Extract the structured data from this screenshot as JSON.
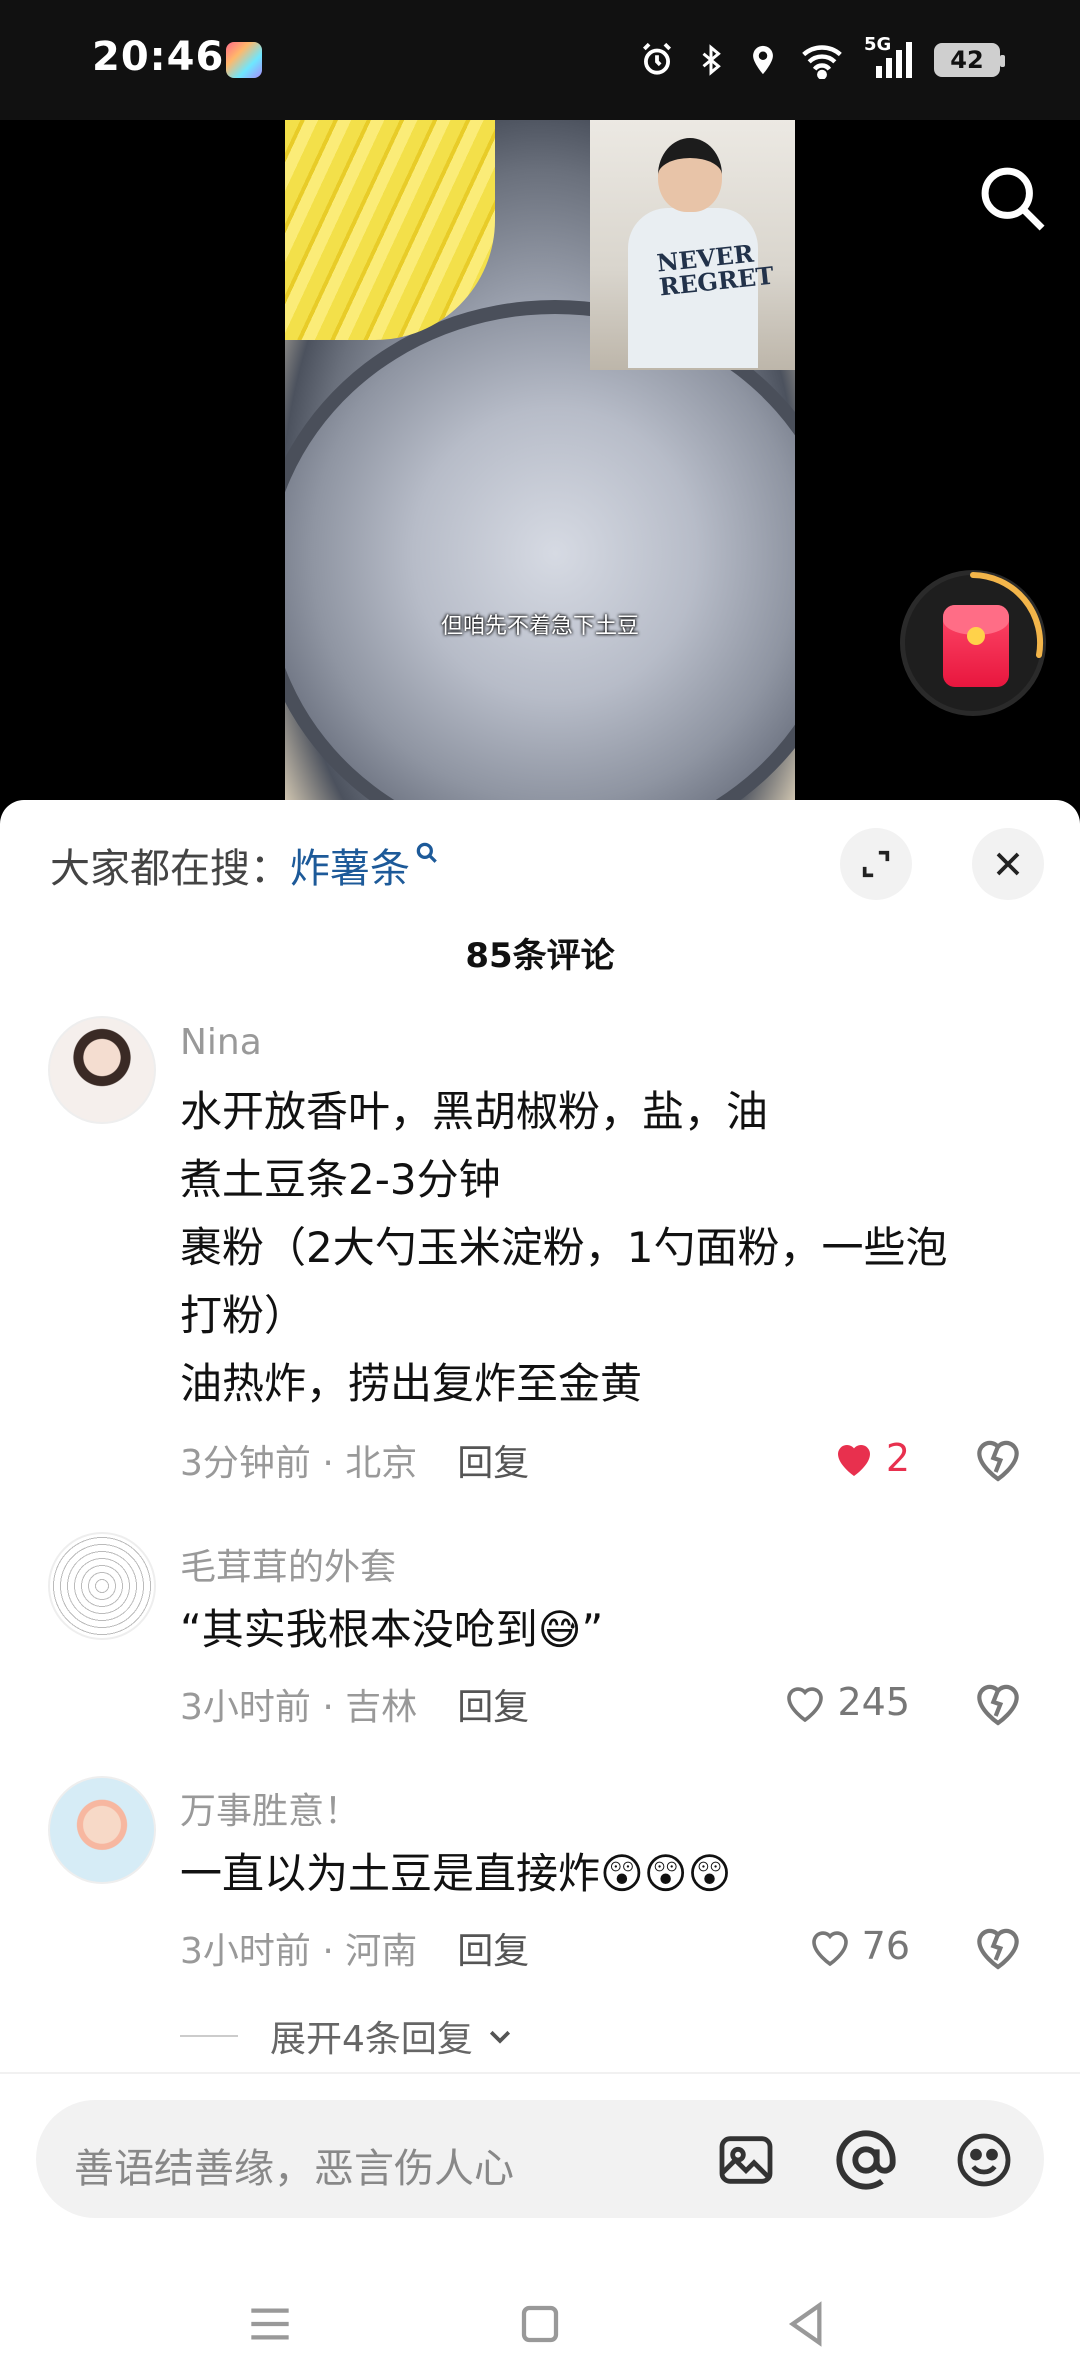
{
  "status_bar": {
    "time": "20:46",
    "network": "5G",
    "battery": "42"
  },
  "video": {
    "subtitle": "但咱先不着急下土豆",
    "pip_shirt_text": "NEVER REGRET"
  },
  "sheet": {
    "hot_search_prefix": "大家都在搜：",
    "hot_search_keyword": "炸薯条",
    "comment_count": "85条评论",
    "comments": [
      {
        "user": "Nina",
        "lines": [
          "水开放香叶，黑胡椒粉，盐，油",
          "煮土豆条2-3分钟",
          "裹粉（2大勺玉米淀粉，1勺面粉，一些泡",
          "打粉）",
          "油热炸，捞出复炸至金黄"
        ],
        "meta": "3分钟前 · 北京",
        "reply_label": "回复",
        "likes": "2",
        "liked": true
      },
      {
        "user": "毛茸茸的外套",
        "lines": [
          "“其实我根本没呛到😅”"
        ],
        "meta": "3小时前 · 吉林",
        "reply_label": "回复",
        "likes": "245",
        "liked": false
      },
      {
        "user": "万事胜意！",
        "lines": [
          "一直以为土豆是直接炸😲😲😲"
        ],
        "meta": "3小时前 · 河南",
        "reply_label": "回复",
        "likes": "76",
        "liked": false
      }
    ],
    "expand_replies": "展开4条回复"
  },
  "input": {
    "placeholder": "善语结善缘，恶言伤人心"
  },
  "colors": {
    "liked": "#e8304e",
    "keyword": "#1d5a99",
    "muted": "#999999"
  }
}
